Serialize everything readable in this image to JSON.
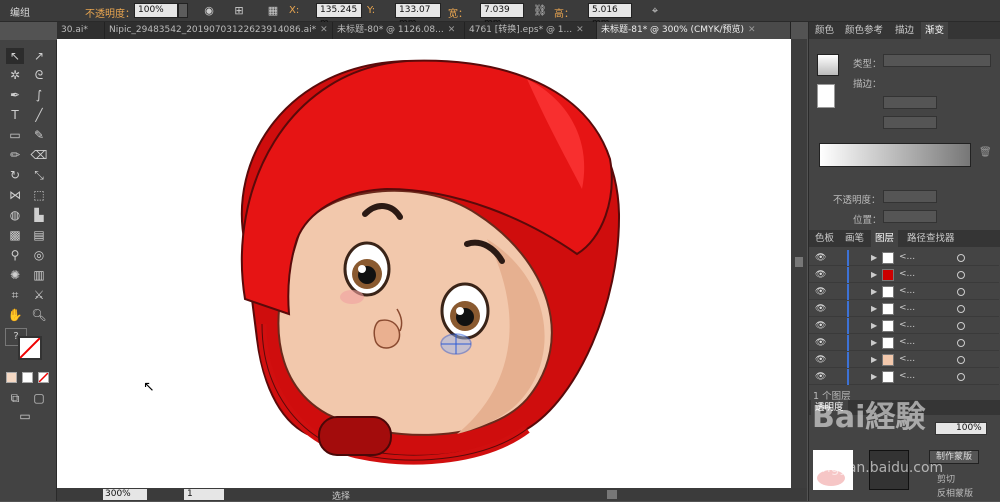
{
  "control_bar": {
    "group_label": "编组",
    "opacity_label": "不透明度：",
    "opacity_value": "100%",
    "x_label": "X:",
    "x_value": "135.245 m",
    "y_label": "Y:",
    "y_value": "133.07 mm",
    "w_label": "宽：",
    "w_value": "7.039 mm",
    "h_label": "高：",
    "h_value": "5.016 mm"
  },
  "doc_tabs": [
    {
      "label": "30.ai*"
    },
    {
      "label": "Nipic_29483542_20190703122623914086.ai*"
    },
    {
      "label": "未标题-80* @ 1126.08..."
    },
    {
      "label": "4761 [转换].eps* @ 1..."
    },
    {
      "label": "未标题-81* @ 300% (CMYK/预览)"
    }
  ],
  "status_bar": {
    "zoom": "300%",
    "page": "1",
    "mode": "选择"
  },
  "color_panel": {
    "tabs": [
      "颜色",
      "颜色参考",
      "描边",
      "渐变"
    ],
    "type_label": "类型：",
    "stroke_label": "描边：",
    "opacity_label": "不透明度：",
    "position_label": "位置："
  },
  "layers_panel": {
    "tabs": [
      "色板",
      "画笔",
      "图层",
      "路径查找器"
    ],
    "footer": "1 个图层",
    "row_names": [
      "<...",
      "<...",
      "<...",
      "<...",
      "<...",
      "<...",
      "<...",
      "<..."
    ]
  },
  "transparency_panel": {
    "title": "透明度",
    "opacity": "100%",
    "make_mask": "制作蒙版",
    "clip": "剪切",
    "invert": "反相蒙版"
  },
  "watermark": "jingyan.baidu.com"
}
